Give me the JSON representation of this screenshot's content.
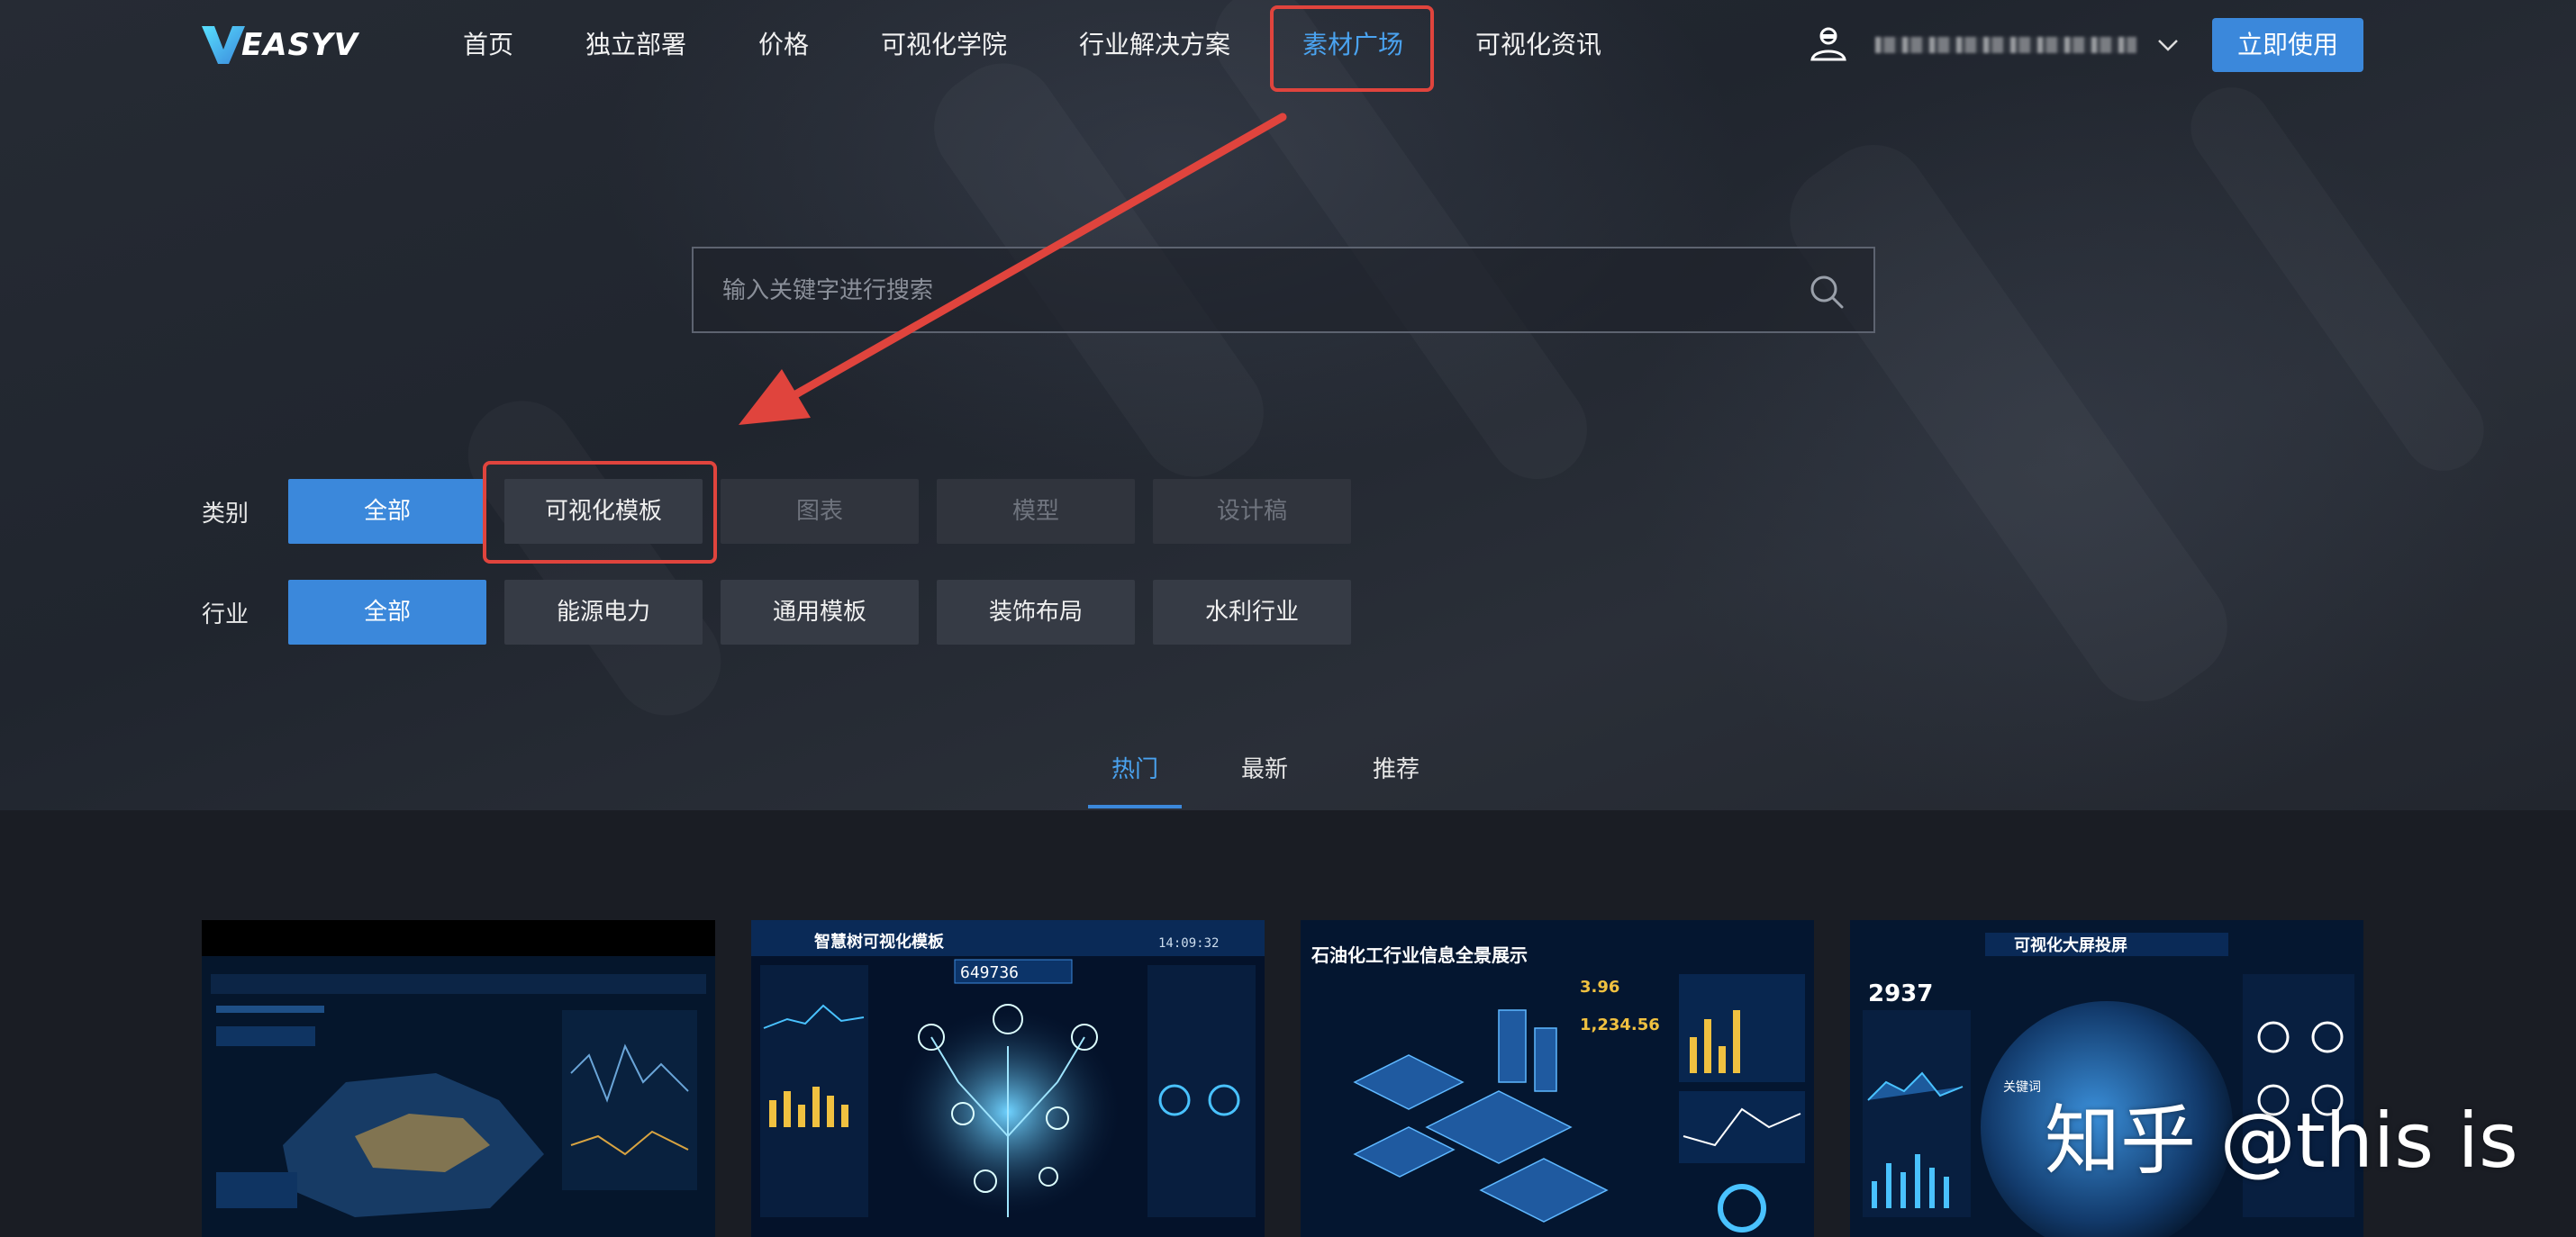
{
  "brand": {
    "logo_text": "EASYV"
  },
  "nav": {
    "items": [
      {
        "label": "首页"
      },
      {
        "label": "独立部署"
      },
      {
        "label": "价格"
      },
      {
        "label": "可视化学院"
      },
      {
        "label": "行业解决方案"
      },
      {
        "label": "素材广场"
      },
      {
        "label": "可视化资讯"
      }
    ],
    "active_index": 5,
    "cta_label": "立即使用"
  },
  "search": {
    "placeholder": "输入关键字进行搜索"
  },
  "filters": {
    "category": {
      "label": "类别",
      "options": [
        "全部",
        "可视化模板",
        "图表",
        "模型",
        "设计稿"
      ],
      "selected": "全部"
    },
    "industry": {
      "label": "行业",
      "options": [
        "全部",
        "能源电力",
        "通用模板",
        "装饰布局",
        "水利行业"
      ],
      "selected": "全部"
    }
  },
  "sort_tabs": {
    "items": [
      "热门",
      "最新",
      "推荐"
    ],
    "active": "热门"
  },
  "templates": [
    {
      "title_hint": ""
    },
    {
      "title_hint": "智慧树可视化模板",
      "counter": "649736",
      "time": "14:09:32"
    },
    {
      "title_hint": "石油化工行业信息全景展示",
      "kpi1": "3.96",
      "kpi2": "1,234.56"
    },
    {
      "title_hint": "可视化大屏投屏",
      "kpi": "2937",
      "kpi2": "2937",
      "globe_label": "关键词"
    }
  ],
  "watermark": {
    "text": "知乎 @this is"
  },
  "colors": {
    "accent": "#3b88db",
    "annotation": "#e0443d",
    "background": "#1b1f27"
  }
}
